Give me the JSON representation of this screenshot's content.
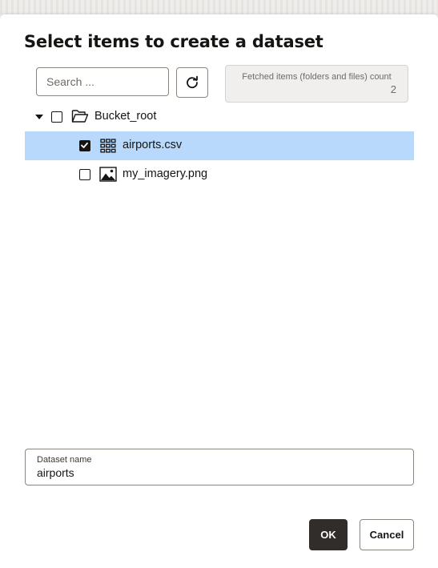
{
  "dialog": {
    "title": "Select items to create a dataset"
  },
  "search": {
    "placeholder": "Search ...",
    "value": ""
  },
  "refresh": {
    "icon": "refresh-icon"
  },
  "fetched_count": {
    "label": "Fetched items (folders and files) count",
    "value": "2"
  },
  "tree": {
    "root": {
      "label": "Bucket_root",
      "expanded": true,
      "checked": false,
      "icon": "folder-open-icon"
    },
    "items": [
      {
        "label": "airports.csv",
        "checked": true,
        "selected": true,
        "icon": "table-grid-icon"
      },
      {
        "label": "my_imagery.png",
        "checked": false,
        "selected": false,
        "icon": "image-icon"
      }
    ]
  },
  "dataset_name": {
    "label": "Dataset name",
    "value": "airports"
  },
  "buttons": {
    "ok": "OK",
    "cancel": "Cancel"
  },
  "colors": {
    "selected_row": "#b9d9fc",
    "primary_button": "#312d2a"
  }
}
